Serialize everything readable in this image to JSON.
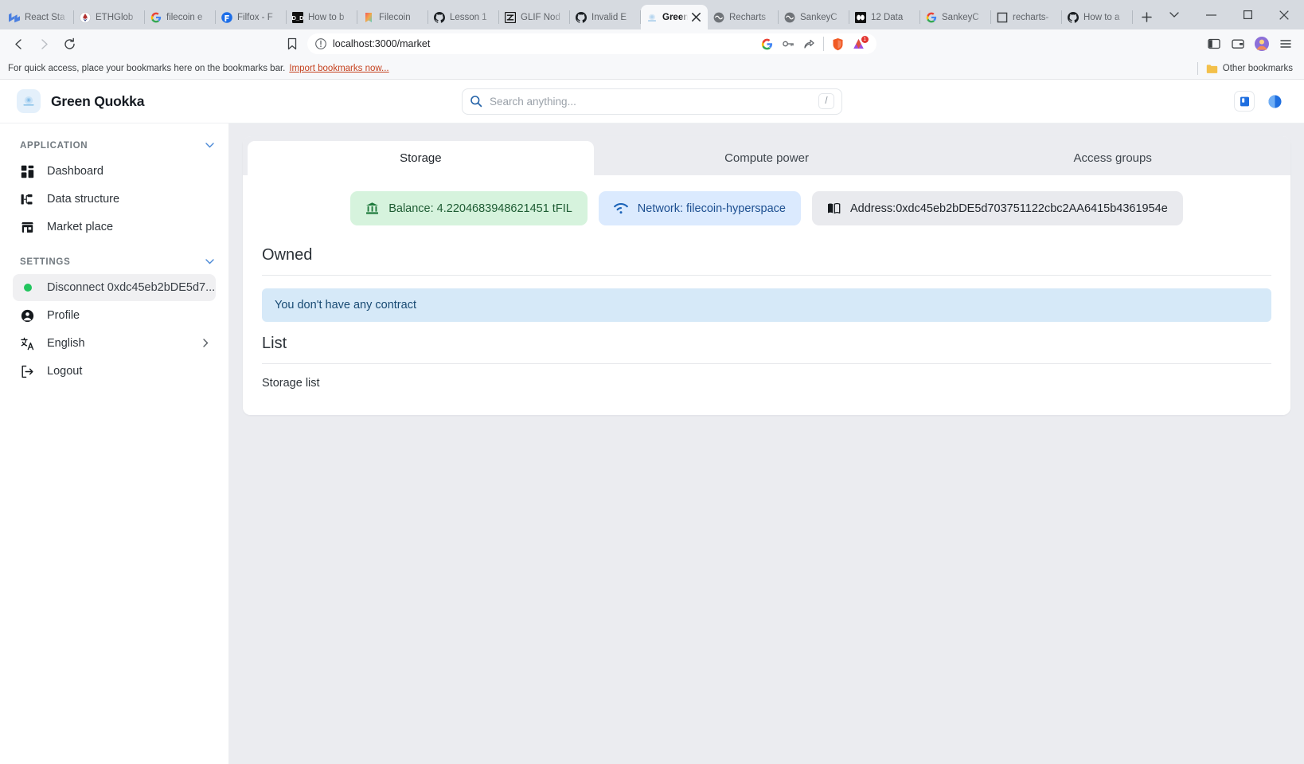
{
  "browser": {
    "tabs": [
      {
        "label": "React Sta",
        "favicon": "material-ui-icon",
        "active": false
      },
      {
        "label": "ETHGlob",
        "favicon": "ethglobal-icon",
        "active": false
      },
      {
        "label": "filecoin e",
        "favicon": "google-icon",
        "active": false
      },
      {
        "label": "Filfox - F",
        "favicon": "filfox-icon",
        "active": false
      },
      {
        "label": "How to b",
        "favicon": "dd-icon",
        "active": false
      },
      {
        "label": "Filecoin",
        "favicon": "filecoin-icon",
        "active": false
      },
      {
        "label": "Lesson 1",
        "favicon": "github-icon",
        "active": false
      },
      {
        "label": "GLIF Nod",
        "favicon": "glif-icon",
        "active": false
      },
      {
        "label": "Invalid E",
        "favicon": "github-icon",
        "active": false
      },
      {
        "label": "Green",
        "favicon": "quokka-icon",
        "active": true
      },
      {
        "label": "Recharts",
        "favicon": "recharts-icon",
        "active": false
      },
      {
        "label": "SankeyC",
        "favicon": "recharts-icon",
        "active": false
      },
      {
        "label": "12 Data",
        "favicon": "observable-icon",
        "active": false
      },
      {
        "label": "SankeyC",
        "favicon": "google-icon",
        "active": false
      },
      {
        "label": "recharts-",
        "favicon": "square-icon",
        "active": false
      },
      {
        "label": "How to a",
        "favicon": "github-icon",
        "active": false
      }
    ],
    "new_tab_label": "+",
    "tab_search_label": "tab-search",
    "window_controls": {
      "minimize": "—",
      "maximize": "☐",
      "close": "✕"
    },
    "nav": {
      "back": "back-arrow",
      "forward": "forward-arrow",
      "reload": "reload-arrow"
    },
    "omnibox": {
      "value": "localhost:3000/market",
      "security": "not-secure-icon"
    },
    "omnibox_actions": [
      "google-lens-icon",
      "password-key-icon",
      "share-icon",
      "brave-shields-icon",
      "brave-rewards-icon"
    ],
    "rewards_badge": "1",
    "toolbar_right": [
      "sidebar-panel-icon",
      "wallet-icon",
      "brave-profile-icon",
      "browser-menu-icon"
    ],
    "bookmarks": {
      "message": "For quick access, place your bookmarks here on the bookmarks bar.",
      "import_link": "Import bookmarks now...",
      "other_bookmarks": "Other bookmarks"
    }
  },
  "app": {
    "brand": {
      "name": "Green Quokka",
      "logo": "quokka-logo"
    },
    "search": {
      "placeholder": "Search anything...",
      "shortcut": "/"
    },
    "header_actions": [
      {
        "name": "docs-book-button",
        "icon": "book-icon"
      },
      {
        "name": "theme-toggle-button",
        "icon": "moon-icon"
      }
    ]
  },
  "sidebar": {
    "sections": [
      {
        "title": "APPLICATION",
        "collapse_icon": "chevron-down-icon",
        "items": [
          {
            "label": "Dashboard",
            "icon": "dashboard-icon",
            "active": false
          },
          {
            "label": "Data structure",
            "icon": "data-structure-icon",
            "active": false
          },
          {
            "label": "Market place",
            "icon": "store-icon",
            "active": false
          }
        ]
      },
      {
        "title": "SETTINGS",
        "collapse_icon": "chevron-down-icon",
        "items": [
          {
            "label": "Disconnect 0xdc45eb2bDE5d7...",
            "icon": "status-dot-icon",
            "active": true
          },
          {
            "label": "Profile",
            "icon": "user-icon",
            "active": false
          },
          {
            "label": "English",
            "icon": "translate-icon",
            "active": false,
            "arrow": "chevron-right-icon"
          },
          {
            "label": "Logout",
            "icon": "logout-icon",
            "active": false
          }
        ]
      }
    ]
  },
  "main": {
    "tabs": [
      {
        "label": "Storage",
        "selected": true
      },
      {
        "label": "Compute power",
        "selected": false
      },
      {
        "label": "Access groups",
        "selected": false
      }
    ],
    "chips": [
      {
        "label": "Balance: 4.2204683948621451 tFIL",
        "icon": "bank-icon",
        "tone": "green"
      },
      {
        "label": "Network: filecoin-hyperspace",
        "icon": "wifi-icon",
        "tone": "blue"
      },
      {
        "label": "Address:0xdc45eb2bDE5d703751122cbc2AA6415b4361954e",
        "icon": "book-open-icon",
        "tone": "gray"
      }
    ],
    "owned_title": "Owned",
    "empty_alert": "You don't have any contract",
    "list_title": "List",
    "storage_list_label": "Storage list"
  },
  "colors": {
    "accent_blue": "#1d4f91",
    "success_green": "#22c55e",
    "chip_green_bg": "#d6f3dd",
    "chip_blue_bg": "#dbeafe",
    "alert_bg": "#d6e9f8",
    "page_bg": "#ebecf0"
  }
}
